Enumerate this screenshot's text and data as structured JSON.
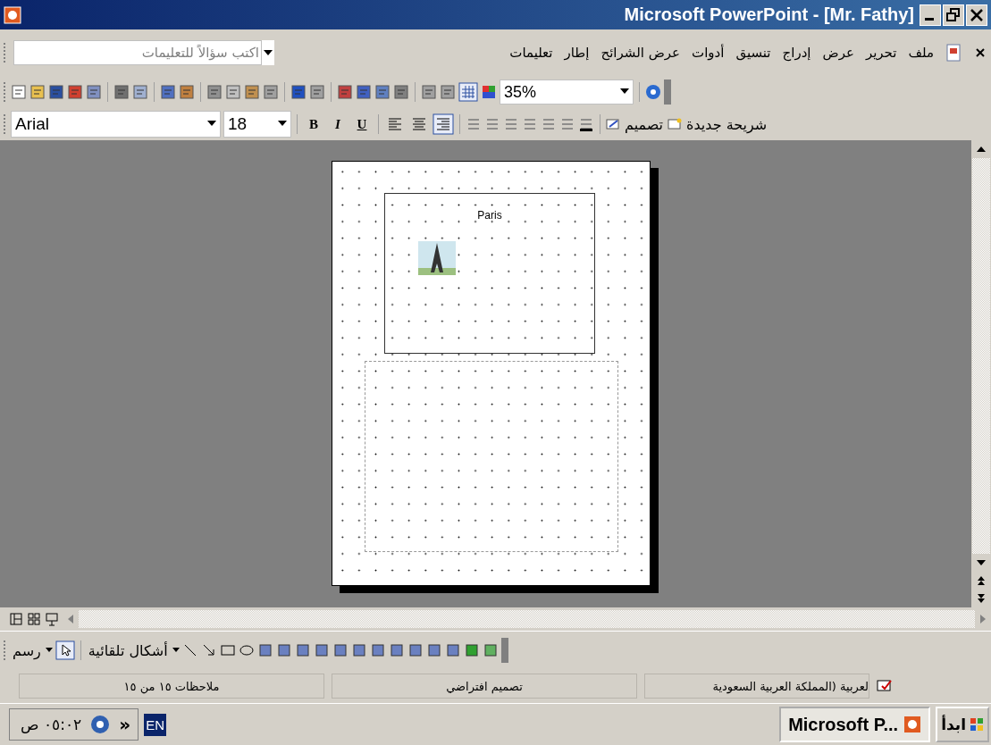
{
  "window": {
    "title": "Microsoft PowerPoint - [Mr. Fathy]"
  },
  "menu_bar": {
    "items": [
      "ملف",
      "تحرير",
      "عرض",
      "إدراج",
      "تنسيق",
      "أدوات",
      "عرض الشرائح",
      "إطار",
      "تعليمات"
    ],
    "help_box": {
      "placeholder": "اكتب سؤالاً للتعليمات"
    }
  },
  "standard_toolbar": {
    "grid_button": {
      "selected": true
    },
    "zoom": "35%"
  },
  "formatting_toolbar": {
    "font": "Arial",
    "size": "18",
    "bold": "B",
    "italic": "I",
    "underline": "U",
    "alignment_buttons": [
      {
        "selected": false
      },
      {
        "selected": false
      },
      {
        "selected": true
      }
    ],
    "design": "تصميم",
    "new_slide": "شريحة جديدة"
  },
  "slide": {
    "title": "Paris"
  },
  "drawing_toolbar": {
    "draw": "رسم",
    "autoshapes": "أشكال تلقائية"
  },
  "status_bar": [
    "لعربية (المملكة العربية السعودية",
    "تصميم افتراضي",
    "ملاحظات ١٥ من ١٥"
  ],
  "taskbar": {
    "start": "ابدأ",
    "task": "Microsoft P...",
    "language": "EN",
    "chevron": "»",
    "clock": "٠٥:٠٢ ص"
  }
}
